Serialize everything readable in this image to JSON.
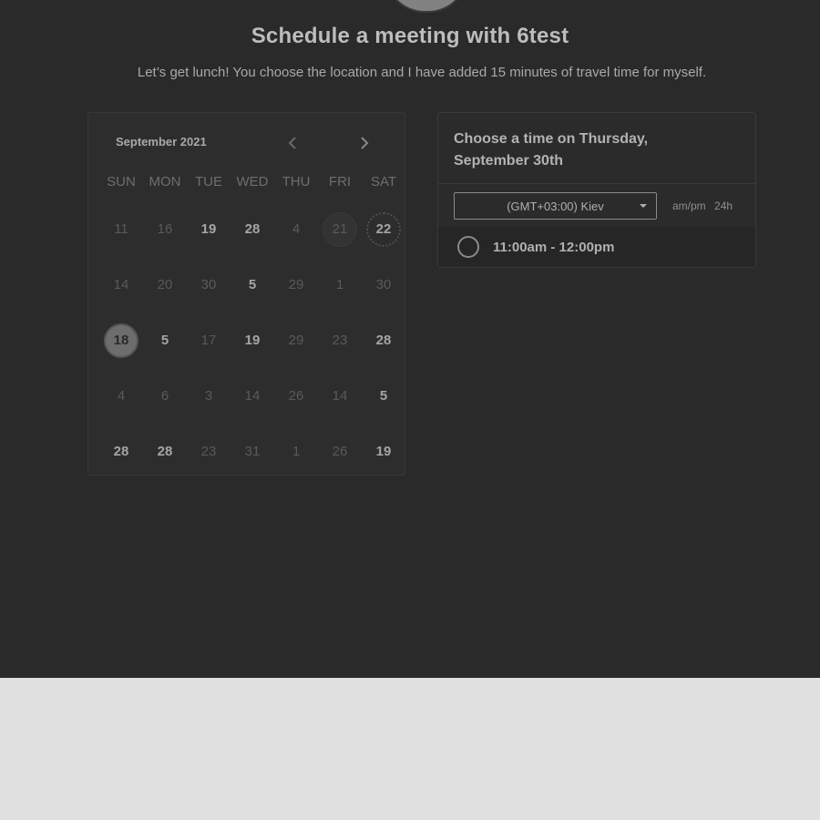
{
  "header": {
    "title": "Schedule a meeting with 6test",
    "description": "Let’s get lunch! You choose the location and I have added 15 minutes of travel time for myself."
  },
  "calendar": {
    "month_label": "September 2021",
    "prev_icon": "chevron-left-icon",
    "next_icon": "chevron-right-icon",
    "weekdays": [
      "SUN",
      "MON",
      "TUE",
      "WED",
      "THU",
      "FRI",
      "SAT"
    ],
    "days": [
      [
        "11",
        "16",
        "19",
        "28",
        "4",
        "21",
        "22"
      ],
      [
        "14",
        "20",
        "30",
        "5",
        "29",
        "1",
        "30"
      ],
      [
        "18",
        "5",
        "17",
        "19",
        "29",
        "23",
        "28"
      ],
      [
        "4",
        "6",
        "3",
        "14",
        "26",
        "14",
        "5"
      ],
      [
        "28",
        "28",
        "23",
        "31",
        "1",
        "26",
        "19"
      ]
    ],
    "selected_day": "18"
  },
  "time_panel": {
    "heading_line1": "Choose a time on Thursday,",
    "heading_line2": "September 30th",
    "timezone_value": "(GMT+03:00) Kiev",
    "format_ampm": "am/pm",
    "format_24h": "24h",
    "slots": [
      {
        "label": "11:00am - 12:00pm"
      }
    ]
  },
  "colors": {
    "page_bg": "#2a2a2a",
    "footer_bg": "#e1e1e1",
    "text_primary": "#bdbdbd"
  }
}
